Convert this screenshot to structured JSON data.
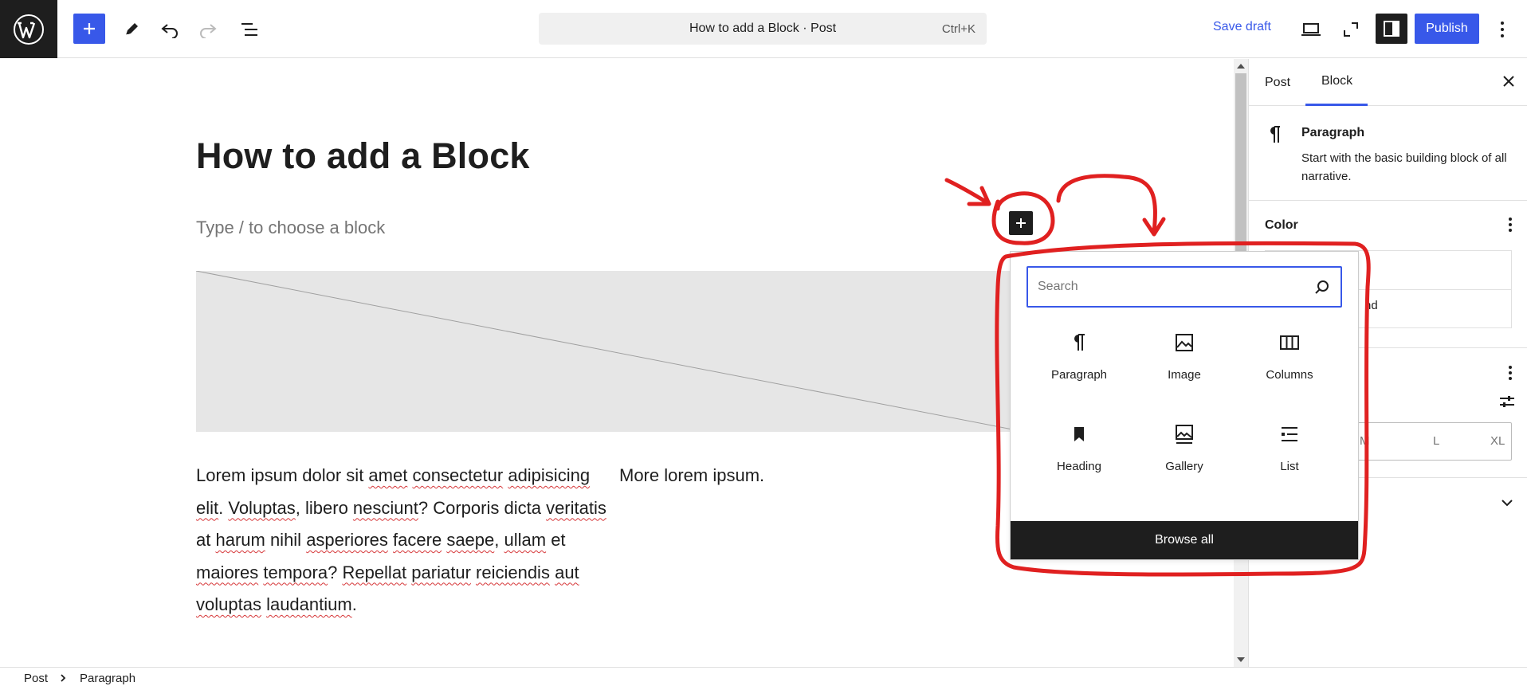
{
  "toolbar": {
    "document_title": "How to add a Block · Post",
    "shortcut": "Ctrl+K",
    "save_draft": "Save draft",
    "publish": "Publish",
    "icons": [
      "wordpress-icon",
      "plus-icon",
      "pencil-icon",
      "undo-icon",
      "redo-icon",
      "list-view-icon",
      "desktop-preview-icon",
      "fullscreen-icon",
      "settings-sidebar-icon",
      "options-icon"
    ]
  },
  "editor": {
    "title": "How to add a Block",
    "placeholder": "Type / to choose a block",
    "column1_text": "Lorem ipsum dolor sit amet consectetur adipisicing elit. Voluptas, libero nesciunt? Corporis dicta veritatis at harum nihil asperiores facere saepe, ullam et maiores tempora? Repellat pariatur reiciendis aut voluptas laudantium.",
    "column2_text": "More lorem ipsum."
  },
  "inserter": {
    "search_placeholder": "Search",
    "items": [
      {
        "label": "Paragraph",
        "icon": "paragraph-icon"
      },
      {
        "label": "Image",
        "icon": "image-icon"
      },
      {
        "label": "Columns",
        "icon": "columns-icon"
      },
      {
        "label": "Heading",
        "icon": "heading-icon"
      },
      {
        "label": "Gallery",
        "icon": "gallery-icon"
      },
      {
        "label": "List",
        "icon": "list-icon"
      }
    ],
    "browse_all": "Browse all"
  },
  "sidebar": {
    "tabs": [
      "Post",
      "Block"
    ],
    "active_tab": "Block",
    "block_name": "Paragraph",
    "block_description": "Start with the basic building block of all narrative.",
    "color_panel_title": "Color",
    "color_item_partial": "nd",
    "size_options": [
      "M",
      "L",
      "XL"
    ]
  },
  "breadcrumb": {
    "items": [
      "Post",
      "Paragraph"
    ]
  },
  "colors": {
    "accent": "#3858e9",
    "dark": "#1e1e1e",
    "annotation": "#e02020"
  }
}
